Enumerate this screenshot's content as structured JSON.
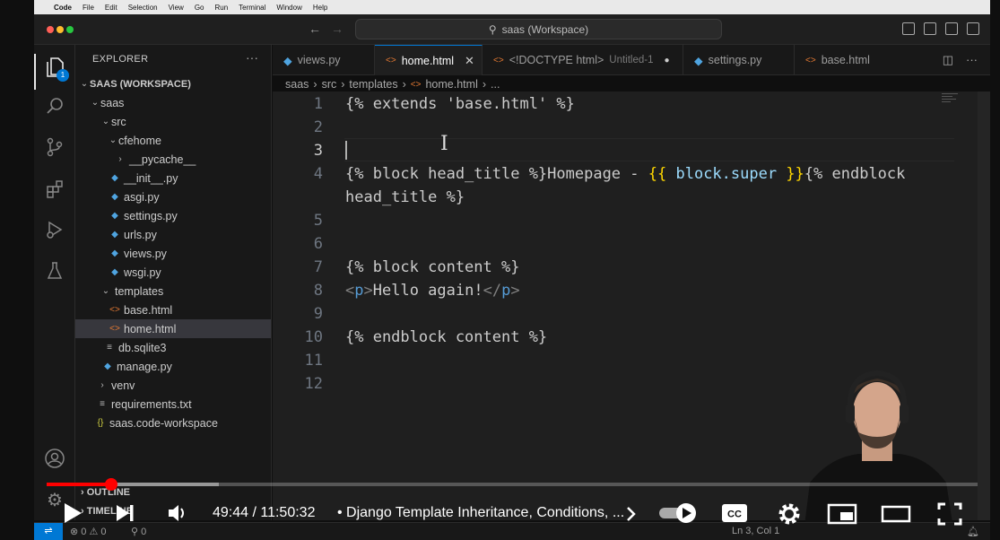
{
  "menubar": {
    "app_name": "Code",
    "items": [
      "File",
      "Edit",
      "Selection",
      "View",
      "Go",
      "Run",
      "Terminal",
      "Window",
      "Help"
    ]
  },
  "titlebar": {
    "command_center": "saas (Workspace)"
  },
  "activity_badge": "1",
  "explorer": {
    "title": "EXPLORER",
    "workspace": "SAAS (WORKSPACE)",
    "tree": [
      {
        "label": "saas",
        "kind": "folder-open"
      },
      {
        "label": "src",
        "kind": "folder-open"
      },
      {
        "label": "cfehome",
        "kind": "folder-open"
      },
      {
        "label": "__pycache__",
        "kind": "folder-closed"
      },
      {
        "label": "__init__.py",
        "kind": "py"
      },
      {
        "label": "asgi.py",
        "kind": "py"
      },
      {
        "label": "settings.py",
        "kind": "py"
      },
      {
        "label": "urls.py",
        "kind": "py"
      },
      {
        "label": "views.py",
        "kind": "py"
      },
      {
        "label": "wsgi.py",
        "kind": "py"
      },
      {
        "label": "templates",
        "kind": "folder-open"
      },
      {
        "label": "base.html",
        "kind": "html"
      },
      {
        "label": "home.html",
        "kind": "html"
      },
      {
        "label": "db.sqlite3",
        "kind": "txt"
      },
      {
        "label": "manage.py",
        "kind": "py"
      },
      {
        "label": "venv",
        "kind": "folder-closed"
      },
      {
        "label": "requirements.txt",
        "kind": "txt"
      },
      {
        "label": "saas.code-workspace",
        "kind": "ws"
      }
    ],
    "outline": "OUTLINE",
    "timeline": "TIMELINE"
  },
  "tabs": [
    {
      "label": "views.py",
      "kind": "py"
    },
    {
      "label": "home.html",
      "kind": "html"
    },
    {
      "label": "<!DOCTYPE html>",
      "desc": "Untitled-1",
      "kind": "html"
    },
    {
      "label": "settings.py",
      "kind": "py"
    },
    {
      "label": "base.html",
      "kind": "html"
    }
  ],
  "breadcrumbs": [
    "saas",
    "src",
    "templates",
    "home.html",
    "..."
  ],
  "editor": {
    "line_numbers": [
      "1",
      "2",
      "3",
      "4",
      "5",
      "6",
      "7",
      "8",
      "9",
      "10",
      "11",
      "12"
    ],
    "line1": "{% extends 'base.html' %}",
    "line4a_pre": "{% block head_title %}Homepage - ",
    "line4a_open": "{{",
    "line4a_var": " block.super ",
    "line4a_close": "}}",
    "line4a_post": "{% endblock",
    "line4b": "head_title %}",
    "line7": "{% block content %}",
    "line8_open_lt": "<",
    "line8_open_tag": "p",
    "line8_open_gt": ">",
    "line8_text": "Hello again!",
    "line8_close_lt": "</",
    "line8_close_tag": "p",
    "line8_close_gt": ">",
    "line10": "{% endblock content %}"
  },
  "player": {
    "timecode": "49:44 / 11:50:32",
    "title": "• Django Template Inheritance, Conditions, ...",
    "progress_fraction": 0.0695
  },
  "statusbar": {
    "remote": "⇌",
    "problems": "⊗ 0 ⚠ 0",
    "ports": "⚲ 0",
    "position": "Ln 3, Col 1"
  },
  "colors": {
    "accent": "#0078d4",
    "progress_red": "#ff0000",
    "editor_bg": "#1f1f1f"
  }
}
